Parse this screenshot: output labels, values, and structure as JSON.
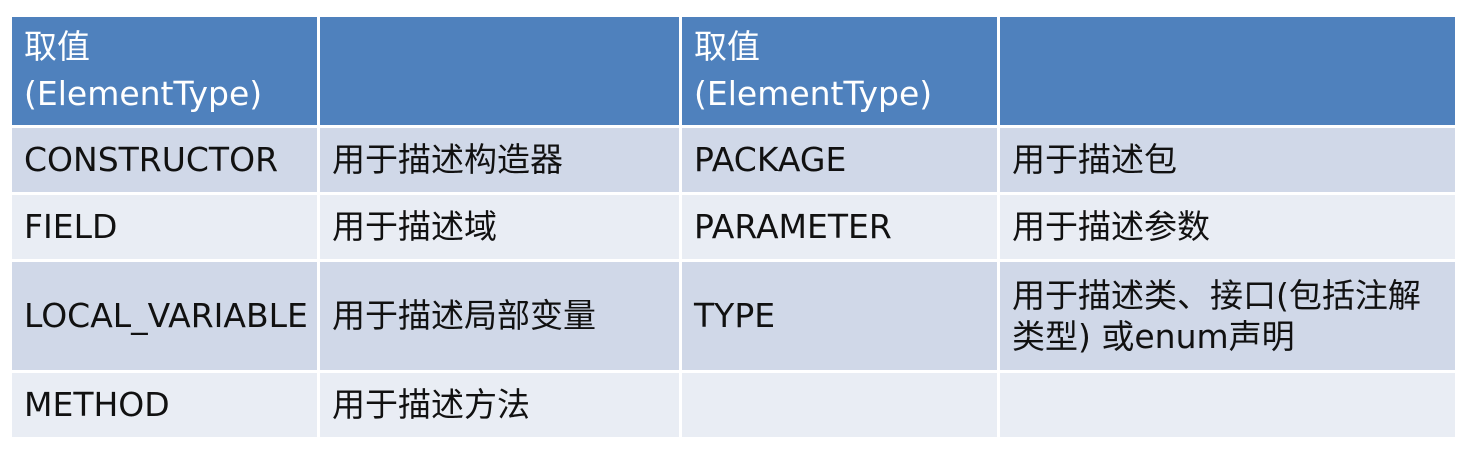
{
  "table": {
    "headers": [
      {
        "line1": "取值",
        "line2": "(ElementType)"
      },
      {
        "line1": "",
        "line2": ""
      },
      {
        "line1": "取值",
        "line2": "(ElementType)"
      },
      {
        "line1": "",
        "line2": ""
      }
    ],
    "rows": [
      [
        "CONSTRUCTOR",
        "用于描述构造器",
        "PACKAGE",
        "用于描述包"
      ],
      [
        "FIELD",
        "用于描述域",
        "PARAMETER",
        "用于描述参数"
      ],
      [
        "LOCAL_VARIABLE",
        "用于描述局部变量",
        "TYPE",
        "用于描述类、接口(包括注解类型) 或enum声明"
      ],
      [
        "METHOD",
        "用于描述方法",
        "",
        ""
      ]
    ]
  },
  "colors": {
    "header_bg": "#4f81bd",
    "row_odd_bg": "#d0d8e8",
    "row_even_bg": "#e9edf4"
  }
}
